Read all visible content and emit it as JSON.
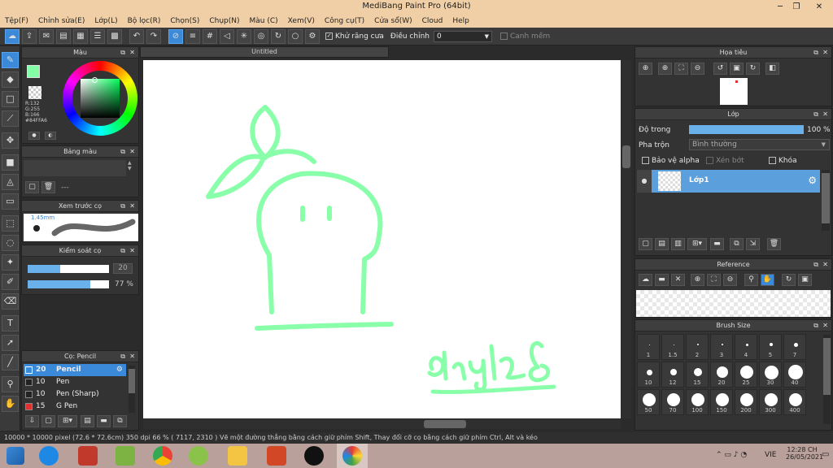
{
  "window": {
    "title": "MediBang Paint Pro (64bit)"
  },
  "menu": [
    "Tệp(F)",
    "Chỉnh sửa(E)",
    "Lớp(L)",
    "Bộ lọc(R)",
    "Chọn(S)",
    "Chụp(N)",
    "Màu (C)",
    "Xem(V)",
    "Công cụ(T)",
    "Cửa sổ(W)",
    "Cloud",
    "Help"
  ],
  "toolbar": {
    "antialias_label": "Khử răng cưa",
    "adjust_label": "Điều chỉnh",
    "adjust_value": "0",
    "smooth_label": "Canh mềm"
  },
  "color_panel": {
    "title": "Màu",
    "r": "R:132",
    "g": "G:255",
    "b": "B:166",
    "hex": "#84FFA6",
    "fg": "#84ffa6"
  },
  "palette_panel": {
    "title": "Bảng màu",
    "dash": "---"
  },
  "brush_preview": {
    "title": "Xem trước cọ",
    "size": "1.45mm"
  },
  "brush_control": {
    "title": "Kiểm soát cọ",
    "size_value": "20",
    "opacity_value": "77 %",
    "size_frac": 0.4,
    "opacity_frac": 0.77
  },
  "brush_list": {
    "title": "Cọ: Pencil",
    "items": [
      {
        "size": "20",
        "name": "Pencil",
        "color": "#3b8ad9",
        "selected": true
      },
      {
        "size": "10",
        "name": "Pen",
        "color": "#222222",
        "selected": false
      },
      {
        "size": "10",
        "name": "Pen (Sharp)",
        "color": "#222222",
        "selected": false
      },
      {
        "size": "15",
        "name": "G Pen",
        "color": "#e03030",
        "selected": false
      }
    ]
  },
  "canvas": {
    "tab": "Untitled"
  },
  "navigator": {
    "title": "Họa tiêu"
  },
  "layer_panel": {
    "title": "Lớp",
    "opacity_label": "Độ trong",
    "opacity_value": "100 %",
    "opacity_frac": 1.0,
    "blend_label": "Pha trộn",
    "blend_value": "Bình thường",
    "protect_alpha": "Bảo vệ alpha",
    "clip": "Xén bớt",
    "lock": "Khóa",
    "layer_name": "Lớp1"
  },
  "reference_panel": {
    "title": "Reference"
  },
  "brush_size_panel": {
    "title": "Brush Size",
    "sizes": [
      "1",
      "1.5",
      "2",
      "3",
      "4",
      "5",
      "7",
      "10",
      "12",
      "15",
      "20",
      "25",
      "30",
      "40",
      "50",
      "70",
      "100",
      "150",
      "200",
      "300",
      "400"
    ]
  },
  "status": {
    "text": "10000 * 10000 pixel   (72.6 * 72.6cm)   350 dpi   66 %   ( 7117, 2310 )   Vẽ một đường thẳng bằng cách giữ phím Shift, Thay đổi cỡ cọ bằng cách giữ phím Ctrl, Alt và kéo"
  },
  "taskbar": {
    "lang": "VIE",
    "time": "12:28 CH",
    "date": "26/05/2021"
  },
  "colors": {
    "stroke": "#84ffa6",
    "accent": "#3b8ad9"
  }
}
